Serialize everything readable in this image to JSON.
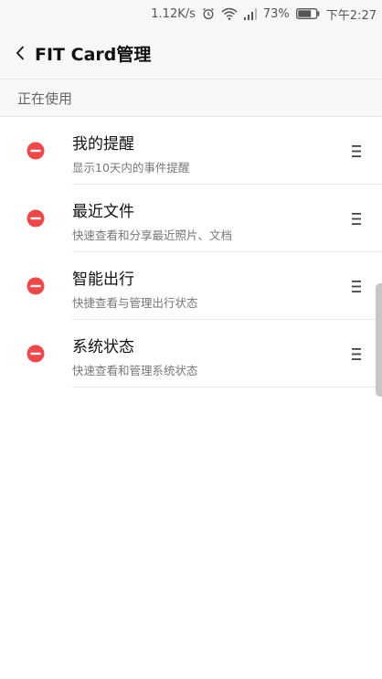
{
  "status_bar": {
    "speed": "1.12K/s",
    "battery_percent": "73%",
    "time": "下午2:27",
    "icons": [
      "alarm-icon",
      "wifi-icon",
      "signal-icon",
      "battery-icon"
    ]
  },
  "header": {
    "title": "FIT Card管理",
    "back_icon": "chevron-left-icon"
  },
  "section": {
    "label": "正在使用"
  },
  "cards": [
    {
      "title": "我的提醒",
      "subtitle": "显示10天内的事件提醒"
    },
    {
      "title": "最近文件",
      "subtitle": "快速查看和分享最近照片、文档"
    },
    {
      "title": "智能出行",
      "subtitle": "快捷查看与管理出行状态"
    },
    {
      "title": "系统状态",
      "subtitle": "快速查看和管理系统状态"
    }
  ],
  "colors": {
    "accent_remove": "#f04848",
    "background": "#ffffff",
    "header_bg": "#f7f7f7",
    "battery_level": 0.73
  }
}
